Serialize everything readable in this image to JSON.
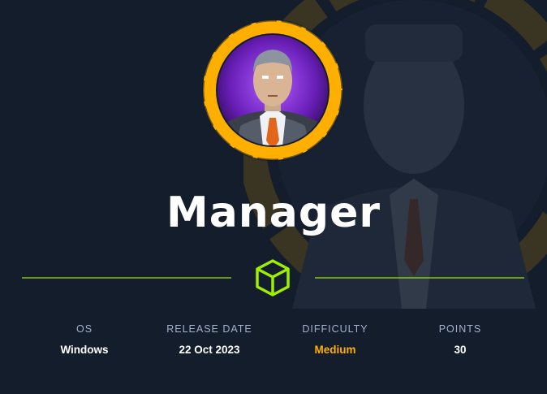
{
  "machine": {
    "name": "Manager"
  },
  "stats": [
    {
      "label": "OS",
      "value": "Windows"
    },
    {
      "label": "RELEASE DATE",
      "value": "22 Oct 2023"
    },
    {
      "label": "DIFFICULTY",
      "value": "Medium"
    },
    {
      "label": "POINTS",
      "value": "30"
    }
  ],
  "colors": {
    "background": "#141d2b",
    "accent": "#9fef00",
    "difficulty_medium": "#ffaf00",
    "label": "#a4b1cd",
    "avatar_ring": "#ffaf00",
    "avatar_inner": "#7a2bd6"
  },
  "icons": {
    "avatar": "manager-avatar-icon",
    "cube": "cube-icon"
  }
}
